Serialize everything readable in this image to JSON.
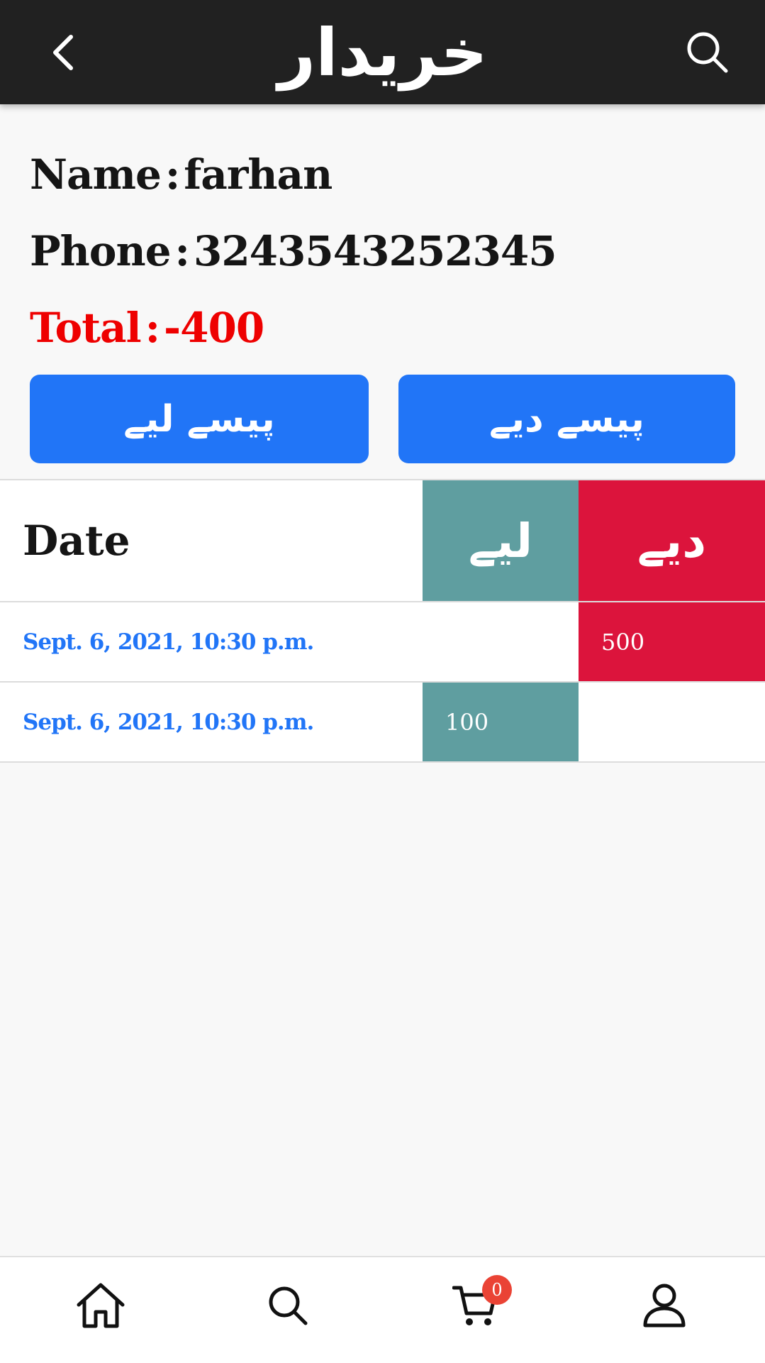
{
  "app_bar": {
    "title": "خریدار",
    "back_icon": "chevron-left-icon",
    "search_icon": "search-icon"
  },
  "customer": {
    "name_label": "Name",
    "name_value": "farhan",
    "phone_label": "Phone",
    "phone_value": "3243543252345",
    "total_label": "Total",
    "total_value": "-400",
    "separator": ":"
  },
  "actions": {
    "received_label": "پیسے لیے",
    "given_label": "پیسے دیے"
  },
  "ledger": {
    "headers": {
      "date": "Date",
      "received": "لیے",
      "given": "دیے"
    },
    "rows": [
      {
        "date": "Sept. 6, 2021, 10:30 p.m.",
        "received": "",
        "given": "500"
      },
      {
        "date": "Sept. 6, 2021, 10:30 p.m.",
        "received": "100",
        "given": ""
      }
    ]
  },
  "bottom_nav": {
    "items": [
      "home-icon",
      "search-icon",
      "cart-icon",
      "profile-icon"
    ],
    "cart_count": "0"
  },
  "colors": {
    "app_bar": "#212121",
    "primary_button": "#2175f7",
    "received_column": "#5f9ea0",
    "given_column": "#dc143c",
    "total_text": "#ee0000",
    "date_text": "#2175f7",
    "badge": "#ea4335"
  }
}
